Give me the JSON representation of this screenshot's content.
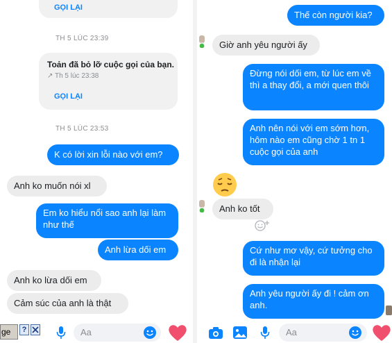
{
  "left": {
    "top_card": {
      "call_back": "GỌI LẠI"
    },
    "timestamp_1": "TH 5 LÚC 23:39",
    "missed_call_card": {
      "title": "Toản đã bỏ lỡ cuộc gọi của bạn.",
      "time": "↗ Th 5 lúc 23:38",
      "call_back": "GỌI LẠI"
    },
    "timestamp_2": "TH 5 LÚC 23:53",
    "messages": [
      {
        "text": "K có lời xin lỗi nào với em?"
      },
      {
        "text": "Anh ko muốn nói xl"
      },
      {
        "text": "Em ko hiểu nổi sao anh lại làm như thế"
      },
      {
        "text": "Anh lừa dối em"
      },
      {
        "text": "Anh ko lừa dối em"
      },
      {
        "text": "Cảm súc của anh là thật"
      }
    ],
    "composer": {
      "placeholder": "Aa",
      "tag_label": "ge",
      "help_label": "?"
    }
  },
  "right": {
    "messages": [
      {
        "text": "Thế còn người kia?"
      },
      {
        "text": "Giờ anh yêu người ấy"
      },
      {
        "text": "Đừng nói dối em, từ lúc em về thì a thay đổi, a mới quen thôi"
      },
      {
        "text": "Anh nên nói với em sớm hơn, hôm nào em cũng chờ 1 tn 1 cuộc gọi của anh"
      },
      {
        "text": "Anh ko tốt"
      },
      {
        "text": "Cứ như mơ vậy, cứ tưởng cho đi là nhận lại"
      },
      {
        "text": "Anh yêu người ấy đi ! cảm ơn anh."
      }
    ],
    "composer": {
      "placeholder": "Aa"
    }
  },
  "colors": {
    "accent": "#0a84ff",
    "incoming_bubble": "#ececec",
    "heart": "#f0506e",
    "online": "#44bb44"
  }
}
